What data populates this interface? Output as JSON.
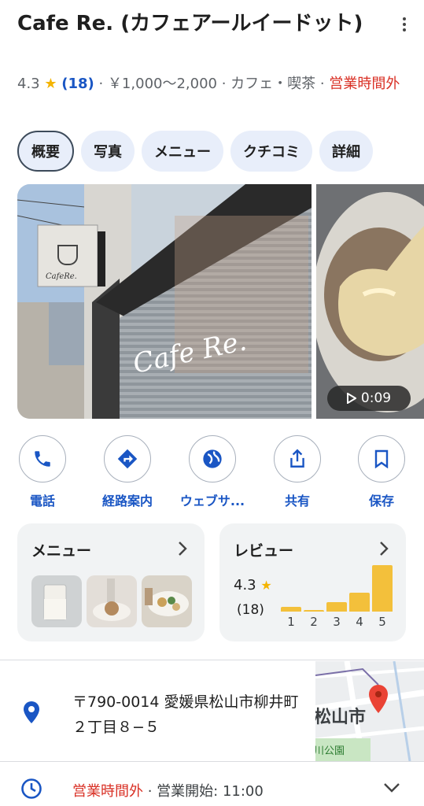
{
  "place": {
    "title": "Cafe Re. (カフェアールイードット)",
    "rating": "4.3",
    "star": "★",
    "review_count": "(18)",
    "sep": " · ",
    "price": "￥1,000〜2,000",
    "category": "カフェ・喫茶",
    "status": "営業時間外"
  },
  "tabs": [
    {
      "label": "概要"
    },
    {
      "label": "写真"
    },
    {
      "label": "メニュー"
    },
    {
      "label": "クチコミ"
    },
    {
      "label": "詳細"
    }
  ],
  "photos": {
    "sign_text": "CafeRe.",
    "window_text": "Cafe Re.",
    "video_duration": "0:09"
  },
  "actions": [
    {
      "label": "電話",
      "icon": "phone-icon"
    },
    {
      "label": "経路案内",
      "icon": "directions-icon"
    },
    {
      "label": "ウェブサ...",
      "icon": "globe-icon"
    },
    {
      "label": "共有",
      "icon": "share-icon"
    },
    {
      "label": "保存",
      "icon": "bookmark-icon"
    }
  ],
  "menu_card": {
    "title": "メニュー"
  },
  "review_card": {
    "title": "レビュー",
    "score": "4.3",
    "star": "★",
    "count": "(18)"
  },
  "chart_data": {
    "type": "bar",
    "categories": [
      "1",
      "2",
      "3",
      "4",
      "5"
    ],
    "values": [
      1,
      0.3,
      2,
      3.8,
      9.5
    ],
    "ylim": [
      0,
      10
    ]
  },
  "address": {
    "text": "〒790-0014 愛媛県松山市柳井町２丁目８−５"
  },
  "map": {
    "label1": "松山市",
    "label2": "川公園"
  },
  "hours": {
    "status": "営業時間外",
    "sep": " · ",
    "next_open": "営業開始: 11:00"
  },
  "colors": {
    "accent": "#1a56c4",
    "closed": "#d93025",
    "star": "#f4b400",
    "bar": "#f3c03b",
    "pin": "#ea4335"
  }
}
